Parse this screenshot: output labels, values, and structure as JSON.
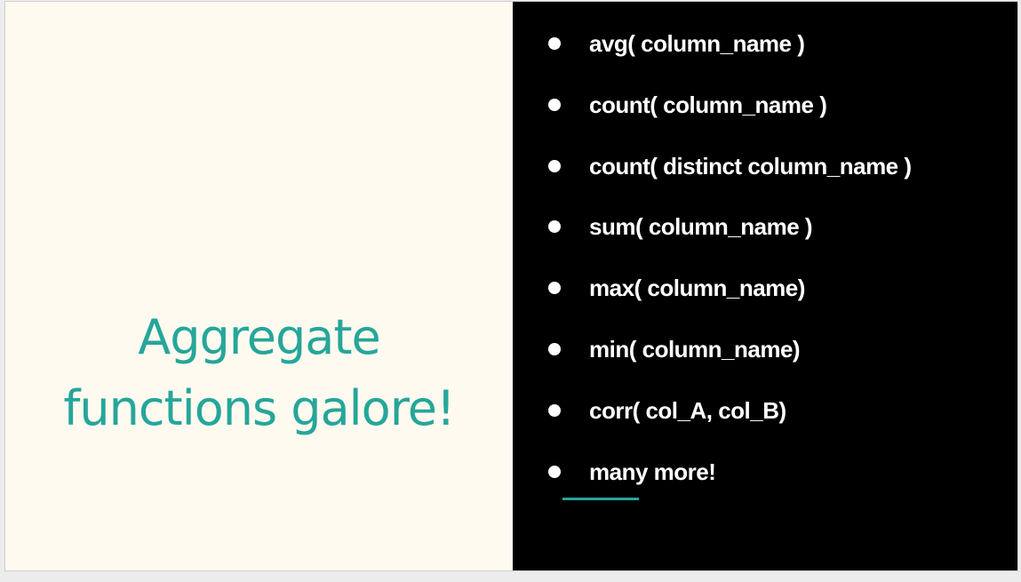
{
  "slide": {
    "title_lines": [
      "Aggregate",
      "functions galore!"
    ],
    "bullets": [
      "avg( column_name )",
      "count( column_name )",
      "count( distinct column_name )",
      "sum( column_name )",
      "max( column_name)",
      "min( column_name)",
      "corr( col_A, col_B)",
      "many more!"
    ],
    "colors": {
      "accent": "#26a69a",
      "left_bg": "#fffaf0",
      "right_bg": "#000000",
      "text": "#ffffff"
    }
  }
}
